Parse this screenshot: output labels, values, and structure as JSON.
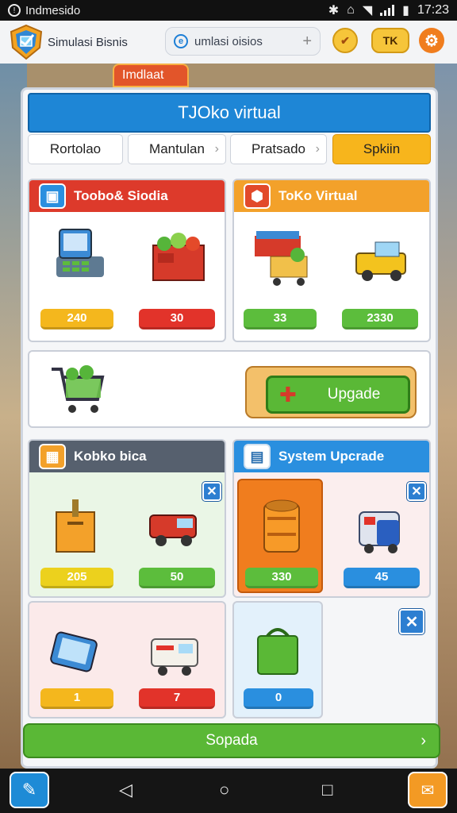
{
  "status_bar": {
    "carrier": "Indmesido",
    "time": "17:23"
  },
  "header": {
    "app_title": "Simulasi Bisnis",
    "search_text": "umlasi oisios",
    "tk_label": "TK"
  },
  "tag_label": "Imdlaat",
  "panel": {
    "title": "TJOko virtual",
    "tabs": [
      {
        "label": "Rortolao"
      },
      {
        "label": "Mantulan"
      },
      {
        "label": "Pratsado"
      },
      {
        "label": "Spkiin"
      }
    ]
  },
  "cards": {
    "store_stock": {
      "title": "Toobo& Siodia",
      "items": [
        {
          "value": "240"
        },
        {
          "value": "30"
        }
      ]
    },
    "toko_virtual": {
      "title": "ToKo Virtual",
      "items": [
        {
          "value": "33"
        },
        {
          "value": "2330"
        }
      ]
    },
    "upgrade_row": {
      "button": "Upgade"
    },
    "kobko": {
      "title": "Kobko bica",
      "items": [
        {
          "value": "205"
        },
        {
          "value": "50"
        }
      ]
    },
    "system_upgrade": {
      "title": "System Upcrade",
      "items": [
        {
          "value": "330"
        },
        {
          "value": "45"
        }
      ]
    },
    "misc_left": {
      "items": [
        {
          "value": "1"
        },
        {
          "value": "7"
        }
      ]
    },
    "misc_right": {
      "items": [
        {
          "value": "0"
        }
      ]
    }
  },
  "bottom_button": "Sopada"
}
